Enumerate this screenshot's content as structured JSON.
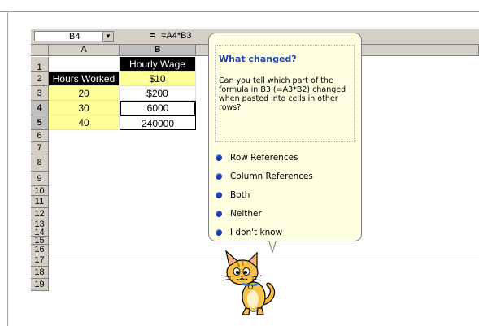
{
  "formula_bar": {
    "name_box": "B4",
    "equals_sign": "=",
    "formula": "=A4*B3"
  },
  "columns": [
    "A",
    "B"
  ],
  "rows": [
    "1",
    "2",
    "3",
    "4",
    "5",
    "6",
    "7",
    "8",
    "9",
    "10",
    "11",
    "12",
    "13",
    "14",
    "15",
    "16",
    "17",
    "18",
    "19"
  ],
  "cells": {
    "b1": "Hourly Wage",
    "a2": "Hours Worked",
    "b2": "$10",
    "a3": "20",
    "b3": "$200",
    "a4": "30",
    "b4": "6000",
    "a5": "40",
    "b5": "240000"
  },
  "bubble": {
    "title": "What changed?",
    "question": "Can you tell which part of the formula in B3 (=A3*B2) changed when pasted into cells in other rows?",
    "options": [
      "Row References",
      "Column References",
      "Both",
      "Neither",
      "I don't know"
    ]
  },
  "colors": {
    "highlight": "#ffff99",
    "bubble_bg": "#ffffe1",
    "title_blue": "#1f3fae"
  },
  "icons": {
    "assistant": "cat-assistant",
    "option_bullet": "radio-bullet-icon",
    "dropdown": "chevron-down-icon"
  }
}
